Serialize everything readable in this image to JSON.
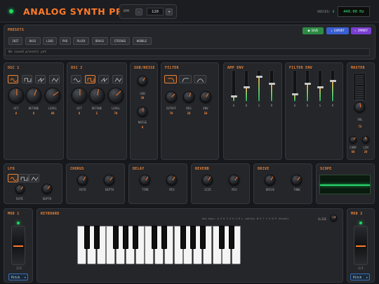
{
  "app": {
    "title": "ANALOG SYNTH PRO"
  },
  "bpm": {
    "label": "BPM",
    "value": "120",
    "minus": "-",
    "plus": "+"
  },
  "voices": {
    "label": "VOICES:",
    "count": "0"
  },
  "frequency_display": "440.00 Hz",
  "presets": {
    "title": "PRESETS",
    "save": "SAVE",
    "export": "↓ EXPORT",
    "import": "↑ IMPORT",
    "items": [
      "INIT",
      "BASS",
      "LEAD",
      "PAD",
      "PLUCK",
      "BRASS",
      "STRINGS",
      "WOBBLE"
    ],
    "empty_text": "No saved presets yet"
  },
  "osc1": {
    "title": "OSC 1",
    "knobs": [
      {
        "label": "OCT",
        "value": "0"
      },
      {
        "label": "DETUNE",
        "value": "0"
      },
      {
        "label": "LEVEL",
        "value": "80"
      }
    ]
  },
  "osc2": {
    "title": "OSC 2",
    "knobs": [
      {
        "label": "OCT",
        "value": "0"
      },
      {
        "label": "DETUNE",
        "value": "5"
      },
      {
        "label": "LEVEL",
        "value": "70"
      }
    ]
  },
  "subnoise": {
    "title": "SUB/NOISE",
    "sub": {
      "label": "SUB",
      "value": "30"
    },
    "noise": {
      "label": "NOISE",
      "value": "0"
    }
  },
  "filter": {
    "title": "FILTER",
    "knobs": [
      {
        "label": "CUTOFF",
        "value": "70"
      },
      {
        "label": "RES",
        "value": "20"
      },
      {
        "label": "ENV",
        "value": "50"
      }
    ]
  },
  "ampenv": {
    "title": "AMP ENV",
    "labels": [
      "A",
      "D",
      "S",
      "R"
    ],
    "levels": [
      0.15,
      0.45,
      0.8,
      0.55
    ]
  },
  "filterenv": {
    "title": "FILTER ENV",
    "labels": [
      "A",
      "D",
      "S",
      "R"
    ],
    "levels": [
      0.2,
      0.55,
      0.45,
      0.65
    ]
  },
  "master": {
    "title": "MASTER",
    "vol": {
      "label": "VOL",
      "value": "75"
    },
    "comp": {
      "label": "COMP",
      "value": "60"
    },
    "lim": {
      "label": "LIM",
      "value": "20"
    }
  },
  "lfo": {
    "title": "LFO",
    "rate": "RATE",
    "depth": "DEPTH"
  },
  "chorus": {
    "title": "CHORUS",
    "rate": "RATE",
    "depth": "DEPTH"
  },
  "delay": {
    "title": "DELAY",
    "time": "TIME",
    "mix": "MIX"
  },
  "reverb": {
    "title": "REVERB",
    "size": "SIZE",
    "mix": "MIX"
  },
  "drive": {
    "title": "DRIVE",
    "drive": "DRIVE",
    "tone": "TONE"
  },
  "scope": {
    "title": "SCOPE"
  },
  "keyboard": {
    "title": "KEYBOARD",
    "hint": "Use keys: A S D F G H J K L (white) W E T Y U O P (black)",
    "glide": "GLIDE"
  },
  "mod1": {
    "title": "MOD 1",
    "value": "2/3",
    "target": "Pitch"
  },
  "mod2": {
    "title": "MOD 2",
    "value": "1/1",
    "target": "Pitch"
  },
  "colors": {
    "accent": "#ff7a2a",
    "led": "#1ed760",
    "scope": "#27d86a"
  }
}
